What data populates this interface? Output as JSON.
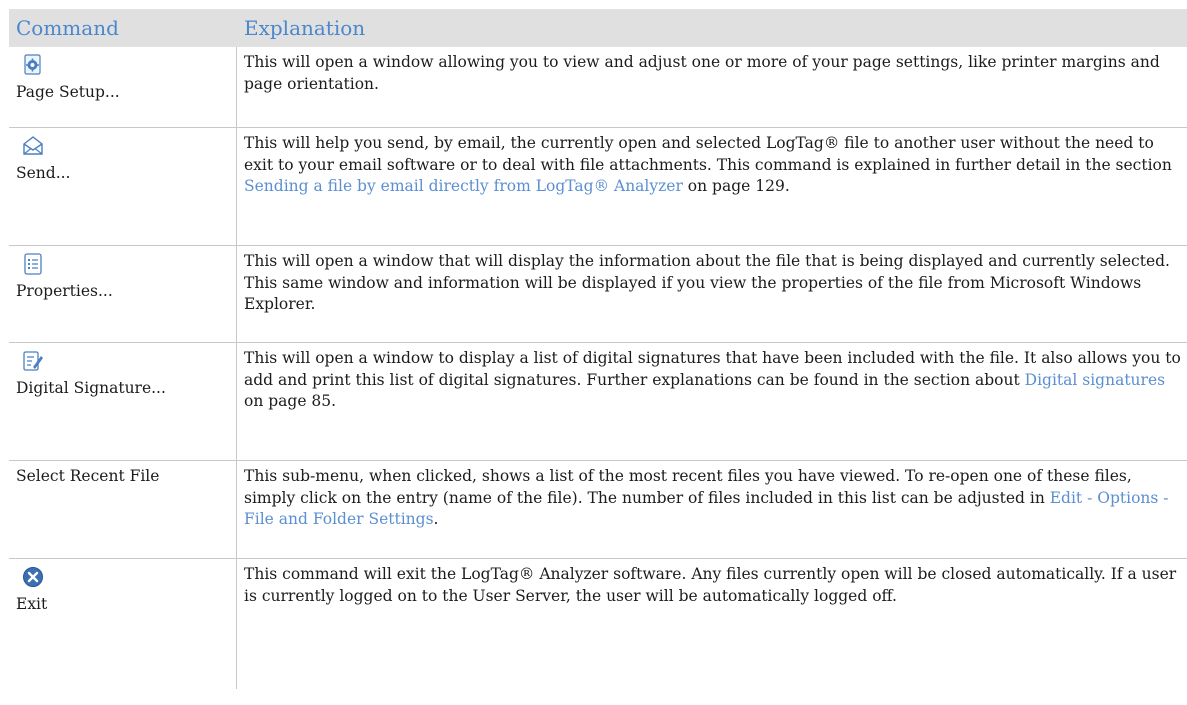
{
  "header": {
    "command": "Command",
    "explanation": "Explanation"
  },
  "rows": [
    {
      "icon": "page-setup-icon",
      "command": "Page Setup...",
      "text": "This will open a window allowing you to view and adjust one or more of your page settings, like printer margins and page orientation."
    },
    {
      "icon": "envelope-icon",
      "command": "Send...",
      "text_before": "This will help you send, by email, the currently open and selected LogTag® file to another user without the need to exit to your email software or to deal with file attachments. This command is explained in further detail in the section ",
      "link": "Sending a file by email directly from LogTag® Analyzer",
      "text_after": " on page 129."
    },
    {
      "icon": "properties-icon",
      "command": "Properties...",
      "text": "This will open a window that will display the information about the file that is being displayed and currently selected. This same window and information will be displayed if you view the properties of the file from Microsoft Windows Explorer."
    },
    {
      "icon": "digital-signature-icon",
      "command": "Digital Signature...",
      "text_before": "This will open a window to display a list of digital signatures that have been included with the file. It also allows you to add and print this list of digital signatures. Further explanations can be found in the section about ",
      "link": "Digital signatures",
      "text_after": " on page 85."
    },
    {
      "command": "Select Recent File",
      "text_before": "This sub-menu, when clicked, shows a list of the most recent files you have viewed. To re-open one of these files, simply click on the entry (name of the file). The number of files included in this list can be adjusted in ",
      "link": "Edit - Options - File and Folder Settings",
      "text_after": "."
    },
    {
      "icon": "exit-icon",
      "command": "Exit",
      "text": "This command will exit the LogTag® Analyzer software. Any files currently open will be closed automatically. If a user is currently logged on to the User Server, the user will be automatically logged off."
    }
  ]
}
